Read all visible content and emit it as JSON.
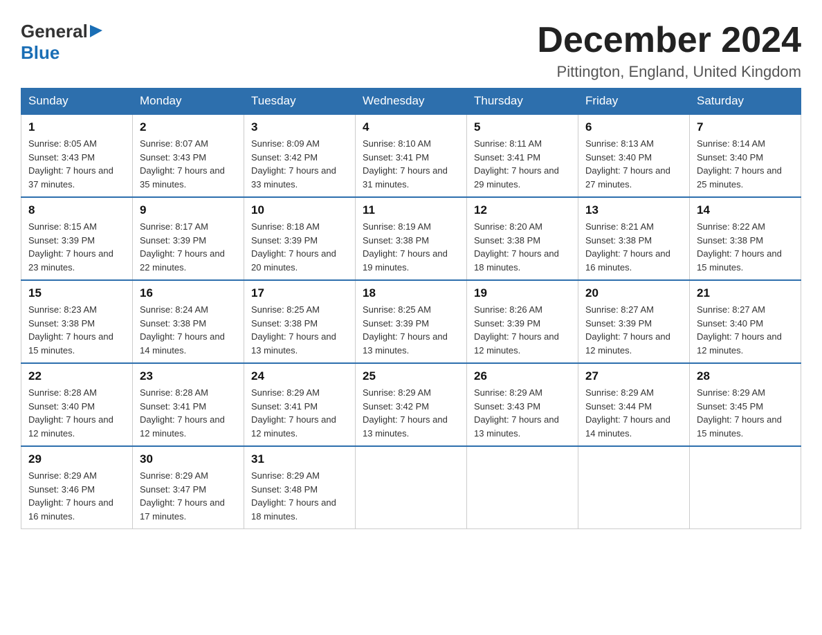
{
  "header": {
    "logo": {
      "general_text": "General",
      "blue_text": "Blue"
    },
    "title": "December 2024",
    "location": "Pittington, England, United Kingdom"
  },
  "calendar": {
    "days_of_week": [
      "Sunday",
      "Monday",
      "Tuesday",
      "Wednesday",
      "Thursday",
      "Friday",
      "Saturday"
    ],
    "weeks": [
      [
        {
          "day": "1",
          "sunrise": "8:05 AM",
          "sunset": "3:43 PM",
          "daylight": "7 hours and 37 minutes."
        },
        {
          "day": "2",
          "sunrise": "8:07 AM",
          "sunset": "3:43 PM",
          "daylight": "7 hours and 35 minutes."
        },
        {
          "day": "3",
          "sunrise": "8:09 AM",
          "sunset": "3:42 PM",
          "daylight": "7 hours and 33 minutes."
        },
        {
          "day": "4",
          "sunrise": "8:10 AM",
          "sunset": "3:41 PM",
          "daylight": "7 hours and 31 minutes."
        },
        {
          "day": "5",
          "sunrise": "8:11 AM",
          "sunset": "3:41 PM",
          "daylight": "7 hours and 29 minutes."
        },
        {
          "day": "6",
          "sunrise": "8:13 AM",
          "sunset": "3:40 PM",
          "daylight": "7 hours and 27 minutes."
        },
        {
          "day": "7",
          "sunrise": "8:14 AM",
          "sunset": "3:40 PM",
          "daylight": "7 hours and 25 minutes."
        }
      ],
      [
        {
          "day": "8",
          "sunrise": "8:15 AM",
          "sunset": "3:39 PM",
          "daylight": "7 hours and 23 minutes."
        },
        {
          "day": "9",
          "sunrise": "8:17 AM",
          "sunset": "3:39 PM",
          "daylight": "7 hours and 22 minutes."
        },
        {
          "day": "10",
          "sunrise": "8:18 AM",
          "sunset": "3:39 PM",
          "daylight": "7 hours and 20 minutes."
        },
        {
          "day": "11",
          "sunrise": "8:19 AM",
          "sunset": "3:38 PM",
          "daylight": "7 hours and 19 minutes."
        },
        {
          "day": "12",
          "sunrise": "8:20 AM",
          "sunset": "3:38 PM",
          "daylight": "7 hours and 18 minutes."
        },
        {
          "day": "13",
          "sunrise": "8:21 AM",
          "sunset": "3:38 PM",
          "daylight": "7 hours and 16 minutes."
        },
        {
          "day": "14",
          "sunrise": "8:22 AM",
          "sunset": "3:38 PM",
          "daylight": "7 hours and 15 minutes."
        }
      ],
      [
        {
          "day": "15",
          "sunrise": "8:23 AM",
          "sunset": "3:38 PM",
          "daylight": "7 hours and 15 minutes."
        },
        {
          "day": "16",
          "sunrise": "8:24 AM",
          "sunset": "3:38 PM",
          "daylight": "7 hours and 14 minutes."
        },
        {
          "day": "17",
          "sunrise": "8:25 AM",
          "sunset": "3:38 PM",
          "daylight": "7 hours and 13 minutes."
        },
        {
          "day": "18",
          "sunrise": "8:25 AM",
          "sunset": "3:39 PM",
          "daylight": "7 hours and 13 minutes."
        },
        {
          "day": "19",
          "sunrise": "8:26 AM",
          "sunset": "3:39 PM",
          "daylight": "7 hours and 12 minutes."
        },
        {
          "day": "20",
          "sunrise": "8:27 AM",
          "sunset": "3:39 PM",
          "daylight": "7 hours and 12 minutes."
        },
        {
          "day": "21",
          "sunrise": "8:27 AM",
          "sunset": "3:40 PM",
          "daylight": "7 hours and 12 minutes."
        }
      ],
      [
        {
          "day": "22",
          "sunrise": "8:28 AM",
          "sunset": "3:40 PM",
          "daylight": "7 hours and 12 minutes."
        },
        {
          "day": "23",
          "sunrise": "8:28 AM",
          "sunset": "3:41 PM",
          "daylight": "7 hours and 12 minutes."
        },
        {
          "day": "24",
          "sunrise": "8:29 AM",
          "sunset": "3:41 PM",
          "daylight": "7 hours and 12 minutes."
        },
        {
          "day": "25",
          "sunrise": "8:29 AM",
          "sunset": "3:42 PM",
          "daylight": "7 hours and 13 minutes."
        },
        {
          "day": "26",
          "sunrise": "8:29 AM",
          "sunset": "3:43 PM",
          "daylight": "7 hours and 13 minutes."
        },
        {
          "day": "27",
          "sunrise": "8:29 AM",
          "sunset": "3:44 PM",
          "daylight": "7 hours and 14 minutes."
        },
        {
          "day": "28",
          "sunrise": "8:29 AM",
          "sunset": "3:45 PM",
          "daylight": "7 hours and 15 minutes."
        }
      ],
      [
        {
          "day": "29",
          "sunrise": "8:29 AM",
          "sunset": "3:46 PM",
          "daylight": "7 hours and 16 minutes."
        },
        {
          "day": "30",
          "sunrise": "8:29 AM",
          "sunset": "3:47 PM",
          "daylight": "7 hours and 17 minutes."
        },
        {
          "day": "31",
          "sunrise": "8:29 AM",
          "sunset": "3:48 PM",
          "daylight": "7 hours and 18 minutes."
        },
        null,
        null,
        null,
        null
      ]
    ]
  }
}
